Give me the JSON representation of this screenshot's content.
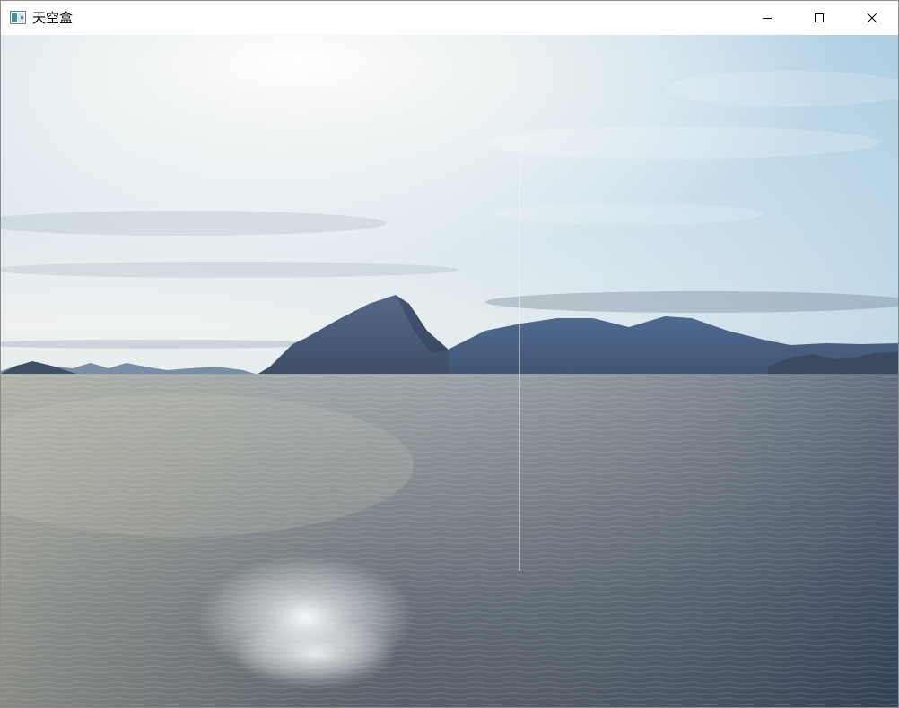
{
  "window": {
    "title": "天空盒",
    "icon": "app-window-icon",
    "controls": {
      "minimize_icon": "minimize-icon",
      "maximize_icon": "maximize-icon",
      "close_icon": "close-icon"
    }
  },
  "scene": {
    "description_icon": "skybox-render",
    "colors": {
      "sky_top": "#b9d6e8",
      "sky_horizon": "#eef2f2",
      "sun_glow": "#ffffff",
      "mountain": "#4a5d7e",
      "mountain_dark": "#35455f",
      "water_light": "#b8b8a8",
      "water_dark": "#34435a",
      "seam_line": "#e8eef4"
    }
  }
}
